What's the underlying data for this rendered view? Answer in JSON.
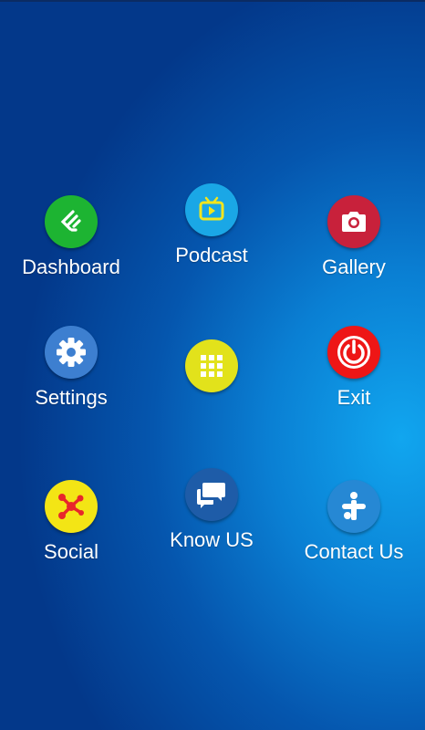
{
  "menu": {
    "dashboard": {
      "label": "Dashboard",
      "icon": "feedly-icon",
      "color": "#1db432"
    },
    "podcast": {
      "label": "Podcast",
      "icon": "tv-play-icon",
      "color": "#1aa7e6"
    },
    "gallery": {
      "label": "Gallery",
      "icon": "camera-icon",
      "color": "#c8213b"
    },
    "settings": {
      "label": "Settings",
      "icon": "gear-icon",
      "color": "#3d7fd0"
    },
    "apps": {
      "label": "",
      "icon": "grid-icon",
      "color": "#e2e21b"
    },
    "exit": {
      "label": "Exit",
      "icon": "power-icon",
      "color": "#ee1616"
    },
    "social": {
      "label": "Social",
      "icon": "social-network-icon",
      "color": "#f3e515"
    },
    "know_us": {
      "label": "Know US",
      "icon": "chat-bubbles-icon",
      "color": "#1e5ca8"
    },
    "contact_us": {
      "label": "Contact Us",
      "icon": "tunein-icon",
      "color": "#2688d4"
    }
  }
}
